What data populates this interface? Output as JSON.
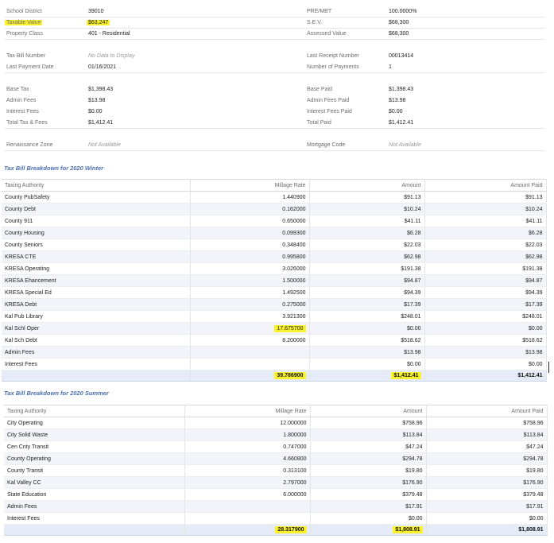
{
  "info": {
    "left": [
      {
        "label": "School District",
        "value": "39010"
      },
      {
        "label": "Taxable Value",
        "value": "$63,247"
      },
      {
        "label": "Property Class",
        "value": "401 - Residential"
      },
      {
        "label": "Tax Bill Number",
        "value": "No Data to Display"
      },
      {
        "label": "Last Payment Date",
        "value": "01/16/2021"
      },
      {
        "label": "Base Tax",
        "value": "$1,398.43"
      },
      {
        "label": "Admin Fees",
        "value": "$13.98"
      },
      {
        "label": "Interest Fees",
        "value": "$0.00"
      },
      {
        "label": "Total Tax & Fees",
        "value": "$1,412.41"
      },
      {
        "label": "Renaissance Zone",
        "value": "Not Available"
      }
    ],
    "right": [
      {
        "label": "PRE/MBT",
        "value": "100.0000%"
      },
      {
        "label": "S.E.V.",
        "value": "$68,300"
      },
      {
        "label": "Assessed Value",
        "value": "$68,300"
      },
      {
        "label": "Last Receipt Number",
        "value": "00013414"
      },
      {
        "label": "Number of Payments",
        "value": "1"
      },
      {
        "label": "Base Paid",
        "value": "$1,398.43"
      },
      {
        "label": "Admin Fees Paid",
        "value": "$13.98"
      },
      {
        "label": "Interest Fees Paid",
        "value": "$0.00"
      },
      {
        "label": "Total Paid",
        "value": "$1,412.41"
      },
      {
        "label": "Mortgage Code",
        "value": "Not Available"
      }
    ]
  },
  "winter": {
    "title": "Tax Bill Breakdown for 2020 Winter",
    "headers": [
      "Taxing Authority",
      "Millage Rate",
      "Amount",
      "Amount Paid"
    ],
    "rows": [
      [
        "County PubSafety",
        "1.440900",
        "$91.13",
        "$91.13"
      ],
      [
        "County Debt",
        "0.162000",
        "$10.24",
        "$10.24"
      ],
      [
        "County 911",
        "0.650000",
        "$41.11",
        "$41.11"
      ],
      [
        "County Housing",
        "0.099300",
        "$6.28",
        "$6.28"
      ],
      [
        "County Seniors",
        "0.348400",
        "$22.03",
        "$22.03"
      ],
      [
        "KRESA CTE",
        "0.995800",
        "$62.98",
        "$62.98"
      ],
      [
        "KRESA Operating",
        "3.026000",
        "$191.38",
        "$191.38"
      ],
      [
        "KRESA Ehancement",
        "1.500000",
        "$94.87",
        "$94.87"
      ],
      [
        "KRESA Special Ed",
        "1.492500",
        "$94.39",
        "$94.39"
      ],
      [
        "KRESA Debt",
        "0.275000",
        "$17.39",
        "$17.39"
      ],
      [
        "Kal Pub Library",
        "3.921300",
        "$248.01",
        "$248.01"
      ],
      [
        "Kal Schl Oper",
        "17.675700",
        "$0.00",
        "$0.00"
      ],
      [
        "Kal Sch Debt",
        "8.200000",
        "$518.62",
        "$518.62"
      ],
      [
        "Admin Fees",
        "",
        "$13.98",
        "$13.98"
      ],
      [
        "Interest Fees",
        "",
        "$0.00",
        "$0.00"
      ]
    ],
    "total": {
      "millage": "39.786900",
      "amount": "$1,412.41",
      "paid": "$1,412.41"
    }
  },
  "summer": {
    "title": "Tax Bill Breakdown for 2020 Summer",
    "headers": [
      "Taxing Authority",
      "Millage Rate",
      "Amount",
      "Amount Paid"
    ],
    "rows": [
      [
        "City Operating",
        "12.000000",
        "$758.96",
        "$758.96"
      ],
      [
        "City Solid Waste",
        "1.800000",
        "$113.84",
        "$113.84"
      ],
      [
        "Cen Cnty Transit",
        "0.747000",
        "$47.24",
        "$47.24"
      ],
      [
        "County Operating",
        "4.660800",
        "$294.78",
        "$294.78"
      ],
      [
        "County Transit",
        "0.313100",
        "$19.80",
        "$19.80"
      ],
      [
        "Kal Valley CC",
        "2.797000",
        "$176.90",
        "$176.90"
      ],
      [
        "State Education",
        "6.000000",
        "$379.48",
        "$379.48"
      ],
      [
        "Admin Fees",
        "",
        "$17.91",
        "$17.91"
      ],
      [
        "Interest Fees",
        "",
        "$0.00",
        "$0.00"
      ]
    ],
    "total": {
      "millage": "28.317900",
      "amount": "$1,808.91",
      "paid": "$1,808.91"
    }
  }
}
